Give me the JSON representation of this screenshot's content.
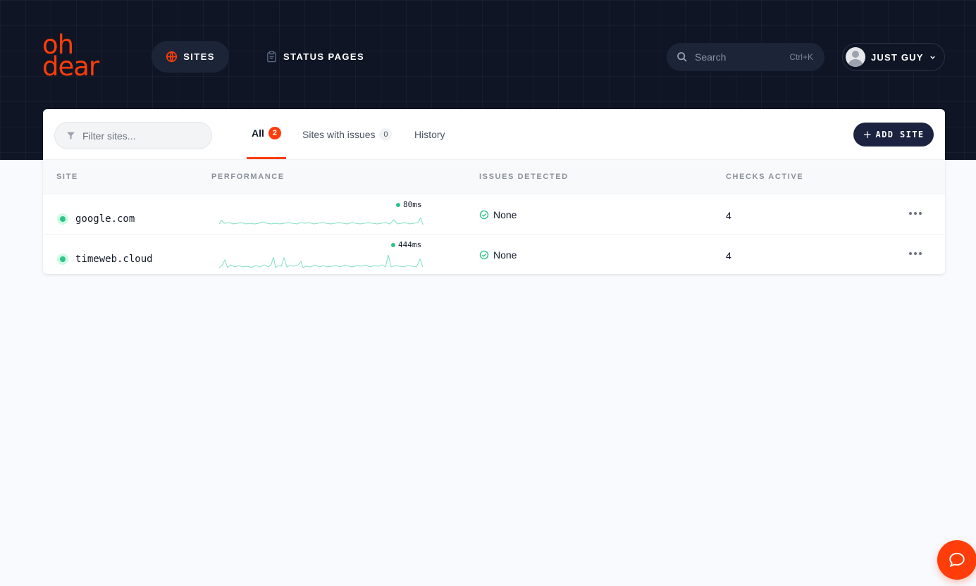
{
  "brand": {
    "line1": "oh",
    "line2": "dear",
    "color": "#ff3d0a"
  },
  "nav": {
    "sites_label": "SITES",
    "sites_icon": "globe-icon",
    "status_pages_label": "STATUS PAGES",
    "status_pages_icon": "clipboard-icon"
  },
  "search": {
    "placeholder": "Search",
    "shortcut": "Ctrl+K"
  },
  "user": {
    "name": "JUST GUY",
    "avatar_icon": "avatar",
    "menu_icon": "chevron-down-icon"
  },
  "filter": {
    "placeholder": "Filter sites...",
    "icon": "funnel-icon"
  },
  "tabs": [
    {
      "label": "All",
      "count": "2",
      "active": true
    },
    {
      "label": "Sites with issues",
      "count": "0"
    },
    {
      "label": "History"
    }
  ],
  "add_site_label": "ADD SITE",
  "table": {
    "headers": [
      "SITE",
      "PERFORMANCE",
      "ISSUES DETECTED",
      "CHECKS ACTIVE"
    ],
    "rows": [
      {
        "site": "google.com",
        "status": "up",
        "response": "80ms",
        "issues": "None",
        "checks": "4"
      },
      {
        "site": "timeweb.cloud",
        "status": "up",
        "response": "444ms",
        "issues": "None",
        "checks": "4"
      }
    ]
  },
  "colors": {
    "accent": "#ff3d0a",
    "header_bg": "#0f1524",
    "success": "#2bc48a",
    "button_dark": "#1c2340"
  },
  "chat_icon": "chat-bubble-icon"
}
